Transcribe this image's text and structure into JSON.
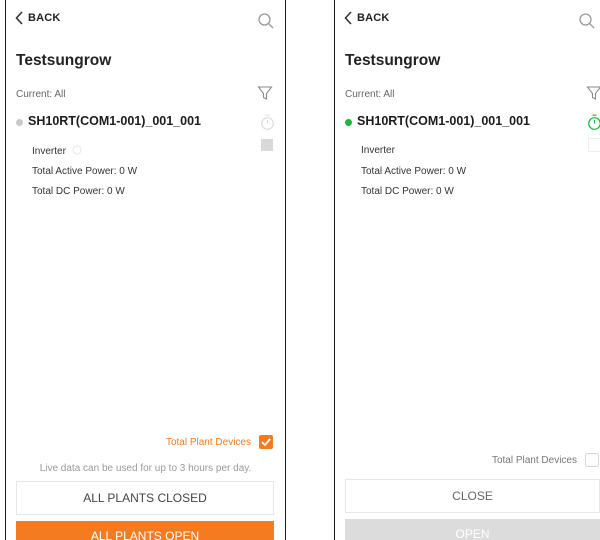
{
  "colors": {
    "accent": "#f47b20",
    "online": "#19b83a",
    "offline": "#c9c9c9",
    "disabled": "#dcdcdc",
    "muted_text": "#9a9a9a"
  },
  "left_screen": {
    "back_label": "BACK",
    "icons": [
      "chevron-left-icon",
      "search-icon",
      "filter-icon",
      "timer-icon",
      "checkbox-icon"
    ],
    "title": "Testsungrow",
    "current": "Current: All",
    "device": {
      "name": "SH10RT(COM1-001)_001_001",
      "status": "offline",
      "type": "Inverter",
      "active_power": "Total Active Power: 0 W",
      "dc_power": "Total DC Power: 0 W",
      "selected": false
    },
    "total_plant_devices": "Total Plant Devices",
    "total_plant_devices_checked": true,
    "live_note": "Live data can be used for up to 3 hours per day.",
    "close_button": "ALL PLANTS CLOSED",
    "open_button": "ALL PLANTS OPEN"
  },
  "right_screen": {
    "back_label": "BACK",
    "title": "Testsungrow",
    "current": "Current: All",
    "device": {
      "name": "SH10RT(COM1-001)_001_001",
      "status": "online",
      "type": "Inverter",
      "active_power": "Total Active Power: 0 W",
      "dc_power": "Total DC Power: 0 W",
      "selected": false
    },
    "total_plant_devices": "Total Plant Devices",
    "total_plant_devices_checked": false,
    "close_button": "CLOSE",
    "open_button": "OPEN",
    "open_enabled": false
  }
}
